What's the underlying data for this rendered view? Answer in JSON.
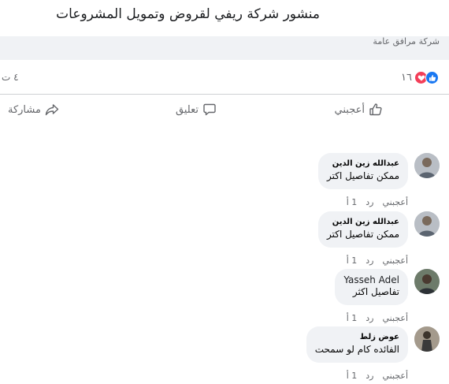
{
  "post": {
    "title": "منشور شركة ريفي لقروض وتمويل المشروعات",
    "category": "شركة مرافق عامة"
  },
  "stats": {
    "reaction_count": "١٦",
    "left_count": "٤ ت",
    "reaction_icons": [
      "like-icon",
      "love-icon"
    ],
    "colors": {
      "like": "#1877f2",
      "love": "#f33e58"
    }
  },
  "actions": {
    "like": "أعجبني",
    "comment": "تعليق",
    "share": "مشاركة"
  },
  "comments": [
    {
      "author": "عبدالله زين الدين",
      "text": "ممكن تفاصيل اكتر",
      "like": "أعجبني",
      "reply": "رد",
      "time": "1 أ"
    },
    {
      "author": "عبدالله زين الدين",
      "text": "ممكن تفاصيل اكتر",
      "like": "أعجبني",
      "reply": "رد",
      "time": "1 أ"
    },
    {
      "author": "Yasseh Adel",
      "text": "تفاصيل اكثر",
      "like": "أعجبني",
      "reply": "رد",
      "time": "1 أ"
    },
    {
      "author": "عوض زلط",
      "text": "الفائده كام لو سمحت",
      "like": "أعجبني",
      "reply": "رد",
      "time": "1 أ"
    }
  ]
}
